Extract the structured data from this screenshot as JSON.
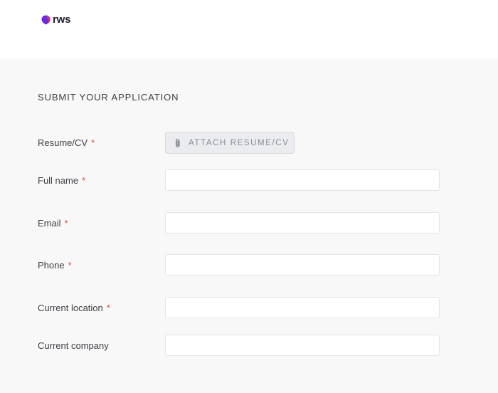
{
  "header": {
    "logo_text": "rws",
    "brand_colors": {
      "purple": "#6b2bd9",
      "magenta": "#d62e8a"
    }
  },
  "form": {
    "title": "SUBMIT YOUR APPLICATION",
    "required_marker": "*",
    "fields": [
      {
        "label": "Resume/CV",
        "required": true,
        "type": "file",
        "button_label": "ATTACH RESUME/CV",
        "icon": "paperclip-icon"
      },
      {
        "label": "Full name",
        "required": true,
        "type": "text",
        "value": "",
        "placeholder": ""
      },
      {
        "label": "Email",
        "required": true,
        "type": "text",
        "value": "",
        "placeholder": ""
      },
      {
        "label": "Phone",
        "required": true,
        "type": "text",
        "value": "",
        "placeholder": ""
      },
      {
        "label": "Current location",
        "required": true,
        "type": "text",
        "value": "",
        "placeholder": ""
      },
      {
        "label": "Current company",
        "required": false,
        "type": "text",
        "value": "",
        "placeholder": ""
      }
    ]
  }
}
